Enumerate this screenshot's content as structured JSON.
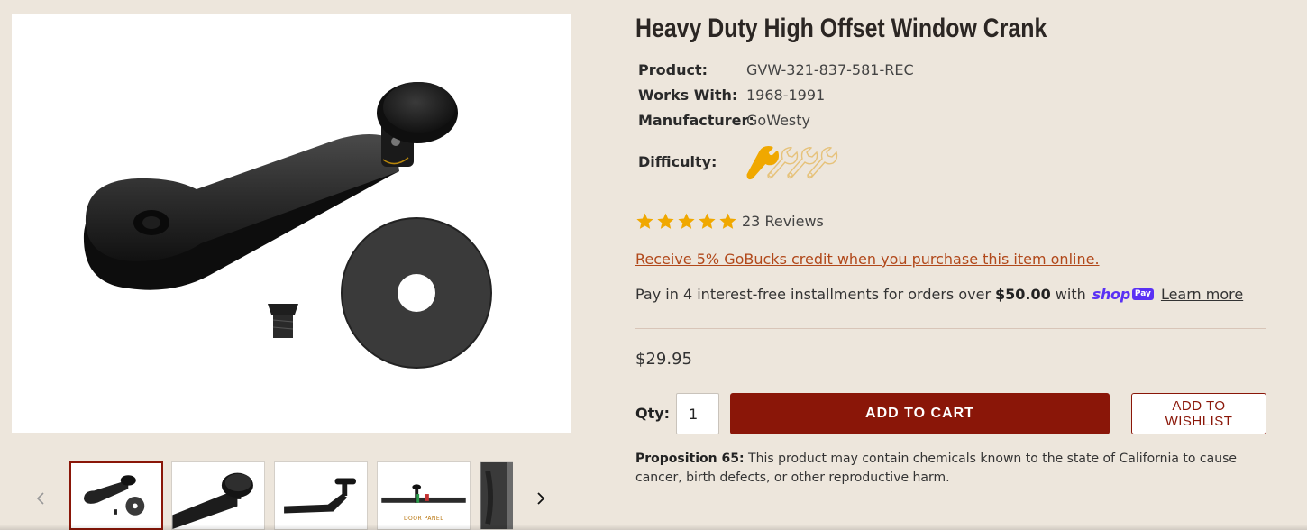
{
  "product": {
    "title": "Heavy Duty High Offset Window Crank",
    "specs": [
      {
        "label": "Product:",
        "value": "GVW-321-837-581-REC"
      },
      {
        "label": "Works With:",
        "value": "1968-1991"
      },
      {
        "label": "Manufacturer:",
        "value": "GoWesty"
      }
    ],
    "difficulty_label": "Difficulty:",
    "difficulty_level": 1,
    "difficulty_max": 4,
    "rating_stars": 5,
    "review_count": "23 Reviews",
    "gobucks_text": "Receive 5% GoBucks credit when you purchase this item online.",
    "installments": {
      "prefix": "Pay in 4 interest-free installments for orders over",
      "amount": "$50.00",
      "suffix": "with",
      "shop_word": "shop",
      "pay_badge": "Pay",
      "learn_more": "Learn more"
    },
    "price": "$29.95"
  },
  "purchase": {
    "qty_label": "Qty:",
    "qty_value": "1",
    "add_to_cart": "ADD TO CART",
    "add_to_wishlist": "ADD TO WISHLIST"
  },
  "prop65": {
    "label": "Proposition 65:",
    "text": "This product may contain chemicals known to the state of California to cause cancer, birth defects, or other reproductive harm."
  },
  "gallery": {
    "thumbnail_caption": "DOOR PANEL"
  },
  "colors": {
    "background": "#ede6dc",
    "brand_red": "#8a1608",
    "link_orange": "#b1481a",
    "star_gold": "#f0a800",
    "shop_purple": "#5a31f4"
  }
}
